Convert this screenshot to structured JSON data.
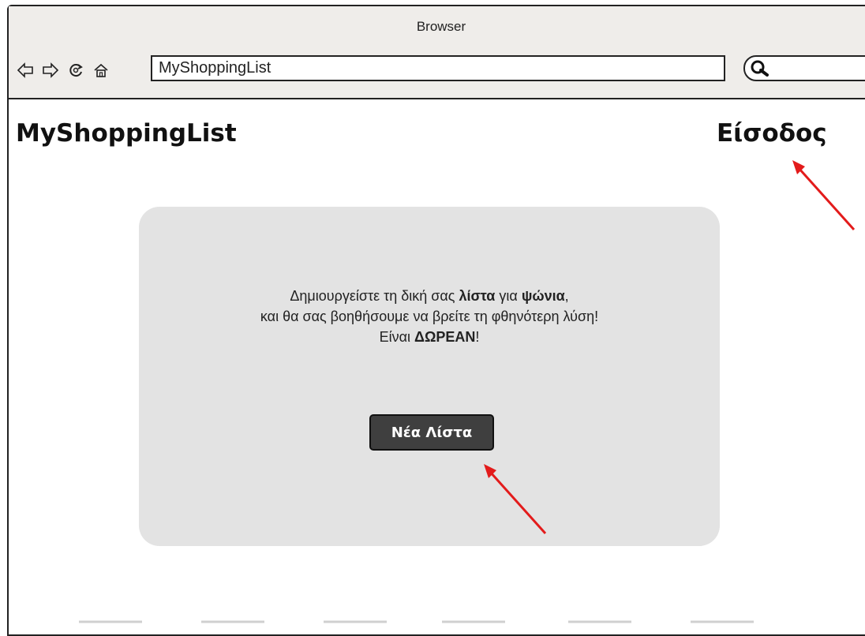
{
  "browser": {
    "title": "Browser",
    "address": "MyShoppingList",
    "icons": [
      "back-arrow-icon",
      "forward-arrow-icon",
      "refresh-icon",
      "home-icon",
      "search-icon"
    ]
  },
  "header": {
    "brand": "MyShoppingList",
    "login_label": "Είσοδος"
  },
  "promo": {
    "line1_a": "Δημιουργείστε τη δική σας ",
    "line1_b": "λίστα",
    "line1_c": " για ",
    "line1_d": "ψώνια",
    "line1_e": ",",
    "line2": "και θα σας βοηθήσουμε να βρείτε τη φθηνότερη λύση!",
    "line3_a": "Είναι ",
    "line3_b": "ΔΩΡΕΑΝ",
    "line3_c": "!"
  },
  "actions": {
    "new_list_label": "Νέα Λίστα"
  },
  "colors": {
    "chrome_bg": "#efedea",
    "panel_bg": "#e3e3e3",
    "button_bg": "#3f3f3f",
    "annotation_arrow": "#e31b1b"
  }
}
